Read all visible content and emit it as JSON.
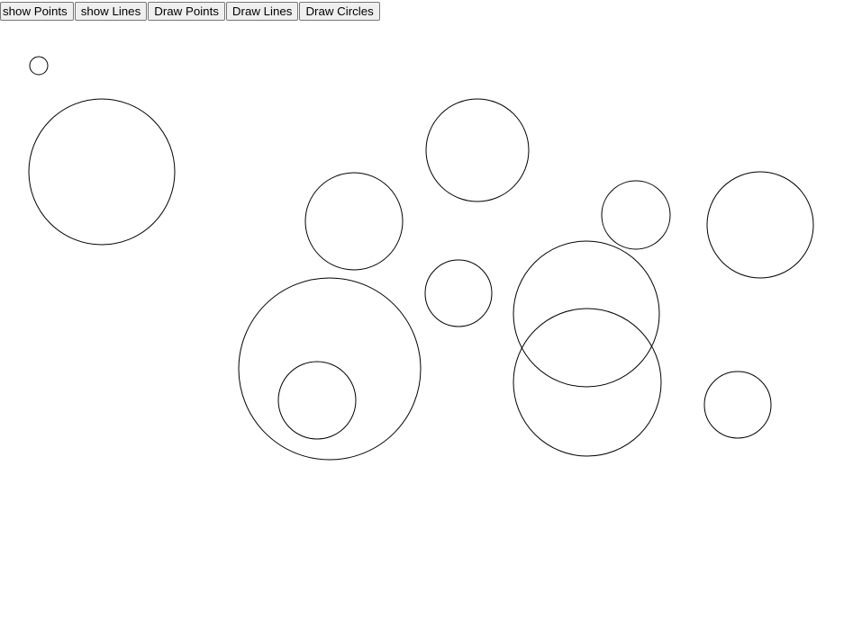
{
  "toolbar": {
    "show_points_label": "show Points",
    "show_lines_label": "show Lines",
    "draw_points_label": "Draw Points",
    "draw_lines_label": "Draw Lines",
    "draw_circles_label": "Draw Circles"
  },
  "colors": {
    "stroke": "#000000",
    "background": "#ffffff",
    "button_face": "#efefef",
    "button_border": "#767676"
  }
}
